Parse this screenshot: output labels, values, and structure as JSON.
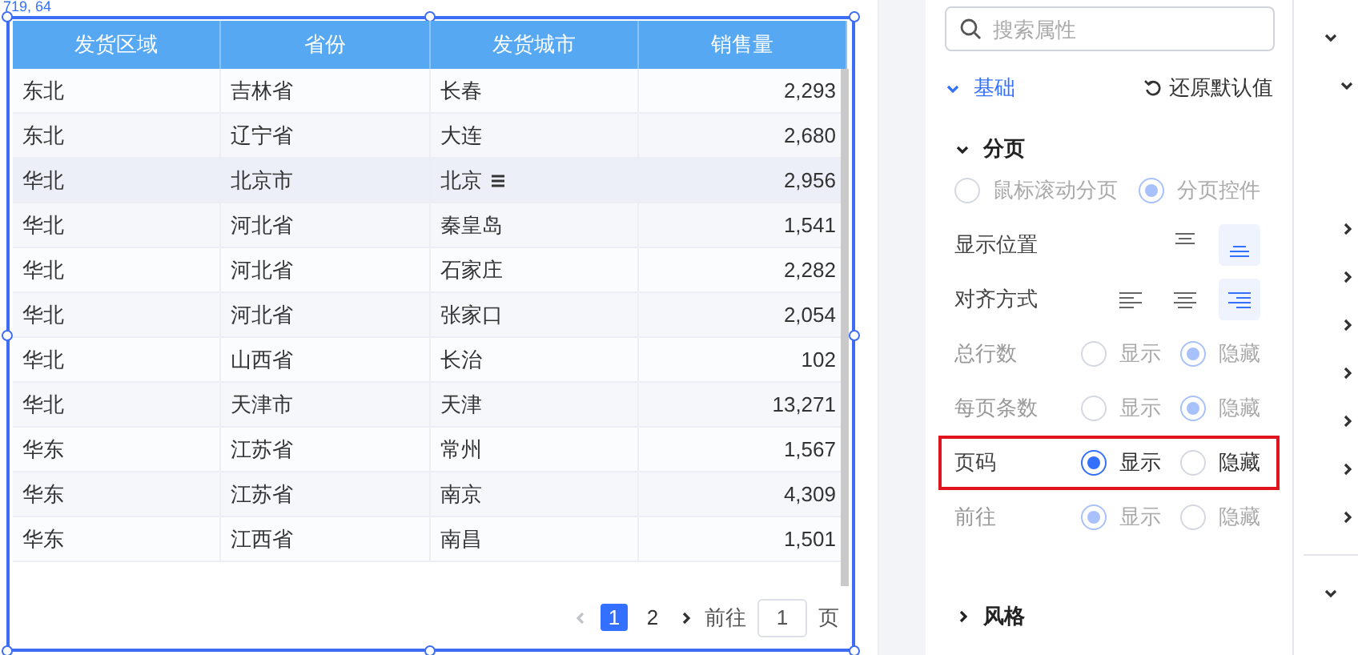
{
  "coordinates": "719, 64",
  "table": {
    "columns": [
      "发货区域",
      "省份",
      "发货城市",
      "销售量"
    ],
    "rows": [
      {
        "cells": [
          "东北",
          "吉林省",
          "长春",
          "2,293"
        ],
        "highlighted": false,
        "menu": false
      },
      {
        "cells": [
          "东北",
          "辽宁省",
          "大连",
          "2,680"
        ],
        "highlighted": false,
        "menu": false
      },
      {
        "cells": [
          "华北",
          "北京市",
          "北京",
          "2,956"
        ],
        "highlighted": true,
        "menu": true
      },
      {
        "cells": [
          "华北",
          "河北省",
          "秦皇岛",
          "1,541"
        ],
        "highlighted": false,
        "menu": false
      },
      {
        "cells": [
          "华北",
          "河北省",
          "石家庄",
          "2,282"
        ],
        "highlighted": false,
        "menu": false
      },
      {
        "cells": [
          "华北",
          "河北省",
          "张家口",
          "2,054"
        ],
        "highlighted": false,
        "menu": false
      },
      {
        "cells": [
          "华北",
          "山西省",
          "长治",
          "102"
        ],
        "highlighted": false,
        "menu": false
      },
      {
        "cells": [
          "华北",
          "天津市",
          "天津",
          "13,271"
        ],
        "highlighted": false,
        "menu": false
      },
      {
        "cells": [
          "华东",
          "江苏省",
          "常州",
          "1,567"
        ],
        "highlighted": false,
        "menu": false
      },
      {
        "cells": [
          "华东",
          "江苏省",
          "南京",
          "4,309"
        ],
        "highlighted": false,
        "menu": false
      },
      {
        "cells": [
          "华东",
          "江西省",
          "南昌",
          "1,501"
        ],
        "highlighted": false,
        "menu": false
      }
    ]
  },
  "pagination": {
    "pages": [
      {
        "label": "1",
        "selected": true
      },
      {
        "label": "2",
        "selected": false
      }
    ],
    "prev_disabled": true,
    "goto_label": "前往",
    "goto_value": "1",
    "page_unit": "页"
  },
  "panel": {
    "search": {
      "placeholder": "搜索属性"
    },
    "section": {
      "title": "基础",
      "expanded": true,
      "reset": "还原默认值"
    },
    "group": {
      "title": "分页",
      "expanded": true
    },
    "settings": [
      {
        "kind": "radio",
        "disabled": true,
        "highlighted": false,
        "options": [
          {
            "label": "鼠标滚动分页",
            "selected": false
          },
          {
            "label": "分页控件",
            "selected": true
          }
        ]
      },
      {
        "kind": "icons",
        "label": "显示位置",
        "icons": [
          {
            "kind": "top",
            "selected": false
          },
          {
            "kind": "bottom",
            "selected": true
          }
        ]
      },
      {
        "kind": "icons",
        "label": "对齐方式",
        "icons": [
          {
            "kind": "left",
            "selected": false
          },
          {
            "kind": "center",
            "selected": false
          },
          {
            "kind": "right",
            "selected": true
          }
        ]
      },
      {
        "kind": "radio",
        "label": "总行数",
        "disabled": true,
        "highlighted": false,
        "options": [
          {
            "label": "显示",
            "selected": false
          },
          {
            "label": "隐藏",
            "selected": true
          }
        ]
      },
      {
        "kind": "radio",
        "label": "每页条数",
        "disabled": true,
        "highlighted": false,
        "options": [
          {
            "label": "显示",
            "selected": false
          },
          {
            "label": "隐藏",
            "selected": true
          }
        ]
      },
      {
        "kind": "radio",
        "label": "页码",
        "disabled": false,
        "highlighted": true,
        "options": [
          {
            "label": "显示",
            "selected": true
          },
          {
            "label": "隐藏",
            "selected": false
          }
        ]
      },
      {
        "kind": "radio",
        "label": "前往",
        "disabled": true,
        "highlighted": false,
        "options": [
          {
            "label": "显示",
            "selected": true
          },
          {
            "label": "隐藏",
            "selected": false
          }
        ]
      }
    ],
    "next_section": {
      "title": "风格",
      "expanded": false
    }
  },
  "side_panel": {
    "items": [
      {
        "kind": "down"
      },
      {
        "kind": "down-indent"
      },
      {
        "kind": "gap"
      },
      {
        "kind": "right"
      },
      {
        "kind": "right"
      },
      {
        "kind": "right"
      },
      {
        "kind": "right"
      },
      {
        "kind": "right"
      },
      {
        "kind": "right"
      },
      {
        "kind": "right"
      },
      {
        "kind": "divider"
      },
      {
        "kind": "down"
      }
    ]
  }
}
